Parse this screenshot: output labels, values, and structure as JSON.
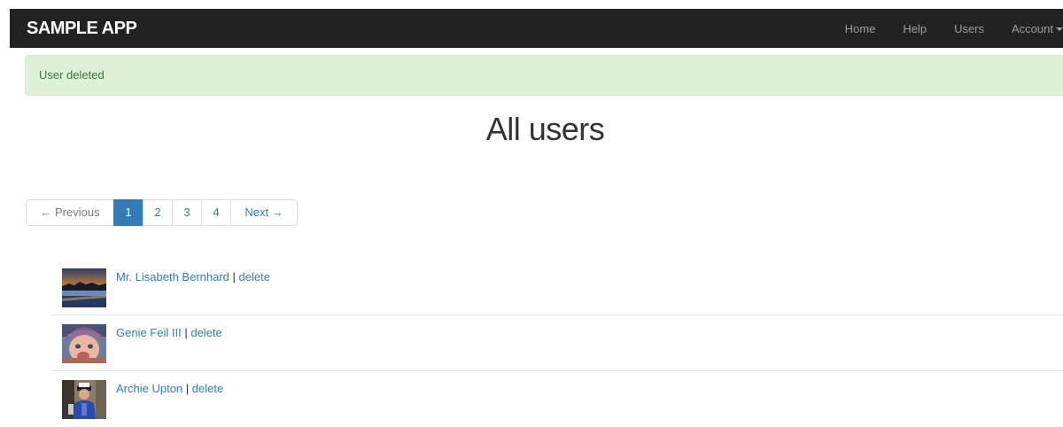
{
  "navbar": {
    "logo": "SAMPLE APP",
    "links": [
      "Home",
      "Help",
      "Users",
      "Account"
    ]
  },
  "alert": {
    "message": "User deleted"
  },
  "page": {
    "title": "All users"
  },
  "pagination": {
    "previous": "← Previous",
    "pages": [
      "1",
      "2",
      "3",
      "4"
    ],
    "next": "Next →",
    "current_page": 1
  },
  "users": [
    {
      "name": "Mr. Lisabeth Bernhard",
      "separator": "|",
      "delete": "delete"
    },
    {
      "name": "Genie Feil III",
      "separator": "|",
      "delete": "delete"
    },
    {
      "name": "Archie Upton",
      "separator": "|",
      "delete": "delete"
    }
  ],
  "colors": {
    "navbar_bg": "#222222",
    "link": "#337ab7",
    "alert_bg": "#dff0d8",
    "alert_text": "#3c763d",
    "active_page": "#337ab7"
  }
}
